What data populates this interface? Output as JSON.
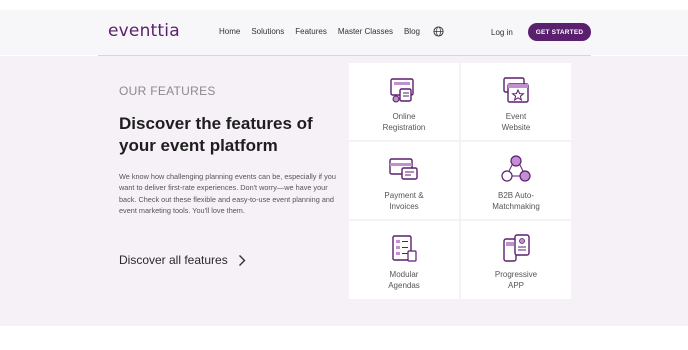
{
  "header": {
    "logo": "eventtia",
    "nav": [
      {
        "label": "Home"
      },
      {
        "label": "Solutions"
      },
      {
        "label": "Features"
      },
      {
        "label": "Master Classes"
      },
      {
        "label": "Blog"
      }
    ],
    "login": "Log in",
    "cta": "GET STARTED"
  },
  "features": {
    "eyebrow": "OUR FEATURES",
    "title": "Discover the features of your event platform",
    "body": "We know how challenging planning events can be, especially if you want to deliver first-rate experiences. Don't worry—we have your back. Check out these flexible and easy-to-use event planning and event marketing tools. You'll love them.",
    "discover_link": "Discover all features",
    "cards": [
      {
        "line1": "Online",
        "line2": "Registration",
        "icon": "online-registration-icon"
      },
      {
        "line1": "Event",
        "line2": "Website",
        "icon": "event-website-icon"
      },
      {
        "line1": "Payment &",
        "line2": "Invoices",
        "icon": "payment-invoices-icon"
      },
      {
        "line1": "B2B Auto-",
        "line2": "Matchmaking",
        "icon": "b2b-matchmaking-icon"
      },
      {
        "line1": "Modular",
        "line2": "Agendas",
        "icon": "modular-agendas-icon"
      },
      {
        "line1": "Progressive",
        "line2": "APP",
        "icon": "progressive-app-icon"
      }
    ]
  },
  "colors": {
    "brand": "#5a1f6e",
    "section_bg": "#f6f0f7",
    "icon_accent": "#c38fd0"
  }
}
